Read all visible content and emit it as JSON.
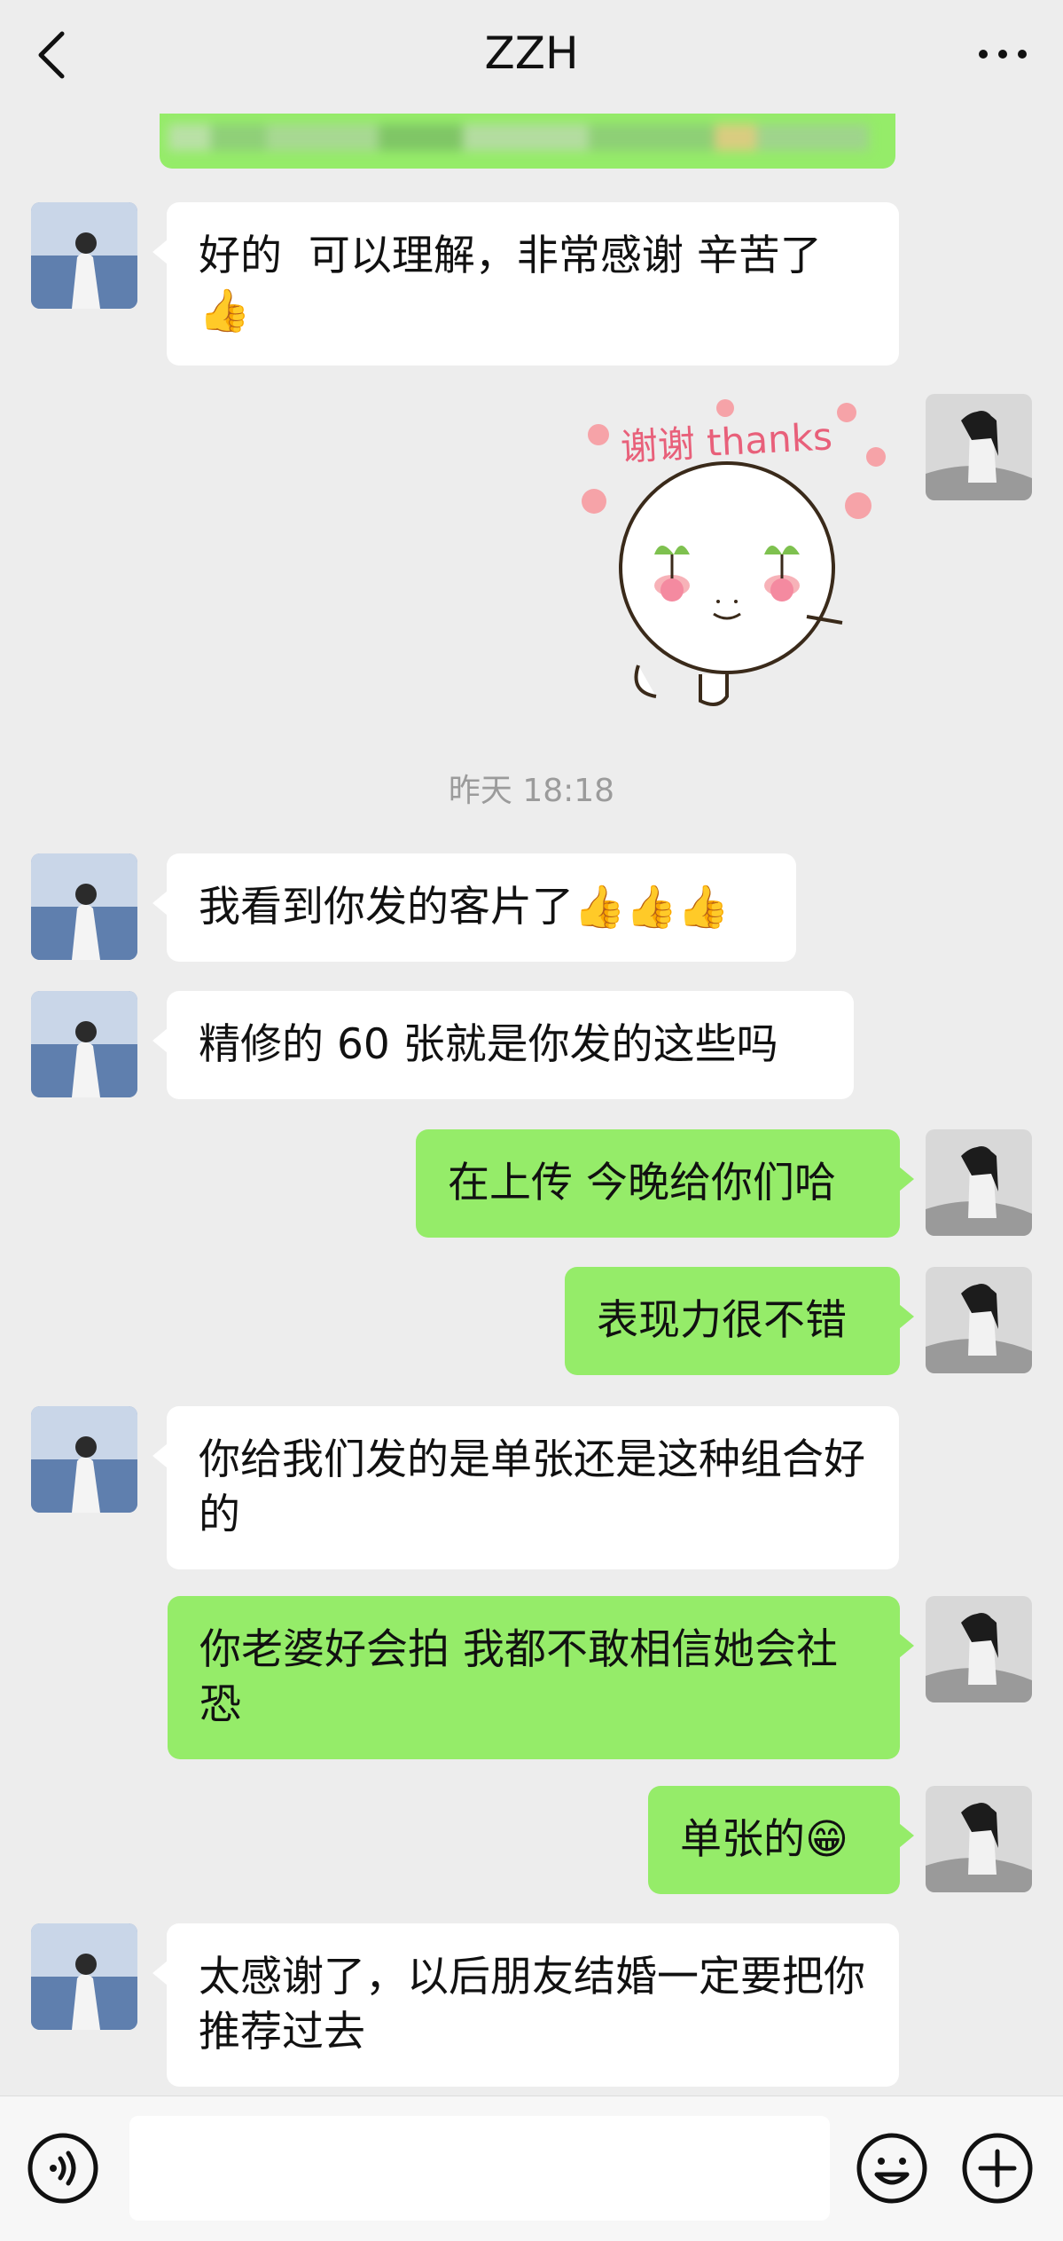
{
  "header": {
    "title": "ZZH"
  },
  "timestamp": "昨天 18:18",
  "sticker": {
    "text": "谢谢 thanks"
  },
  "messages": [
    {
      "text": "好的  可以理解，非常感谢 辛苦了\n👍"
    },
    {
      "text": "我看到你发的客片了👍👍👍"
    },
    {
      "text": "精修的 60 张就是你发的这些吗"
    },
    {
      "text": "在上传 今晚给你们哈"
    },
    {
      "text": "表现力很不错"
    },
    {
      "text": "你给我们发的是单张还是这种组合好的"
    },
    {
      "text": "你老婆好会拍 我都不敢相信她会社恐"
    },
    {
      "text": "单张的😁"
    },
    {
      "text": "太感谢了，以后朋友结婚一定要把你推荐过去"
    }
  ],
  "colors": {
    "outgoing": "#95ec69",
    "incoming": "#ffffff",
    "background": "#ededed"
  },
  "icons": [
    "back-arrow-icon",
    "more-icon",
    "voice-icon",
    "emoji-icon",
    "plus-icon"
  ]
}
